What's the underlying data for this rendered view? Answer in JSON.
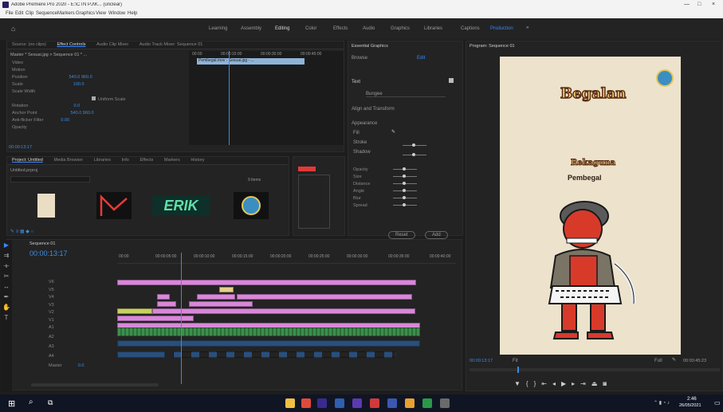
{
  "window": {
    "title": "Adobe Premiere Pro 2020 - E:\\CTN PJ\\K... (unclear)",
    "controls": [
      "—",
      "□",
      "×"
    ]
  },
  "menu": [
    "File",
    "Edit",
    "Clip",
    "Sequence",
    "Markers",
    "Graphics",
    "View",
    "Window",
    "Help"
  ],
  "workspaces": {
    "items": [
      "Learning",
      "Assembly",
      "Editing",
      "Color",
      "Effects",
      "Audio",
      "Graphics",
      "Libraries",
      "Captions",
      "Production"
    ],
    "active": "Editing"
  },
  "source_panel": {
    "tabs": [
      "Source: (no clips)",
      "Effect Controls",
      "Audio Clip Mixer",
      "Audio Track Mixer: Sequence 01"
    ],
    "active_tab": "Effect Controls",
    "header_clip": "Master * Sesuai.jpg > Sequence 01 * ...",
    "timecodes": [
      "00:00",
      "00:00:15:00",
      "00:00:30:00",
      "00:00:45:00"
    ],
    "highlight_clip": "Pembegal.mov - Sesuai.jpg - ...",
    "properties": [
      {
        "name": "Video",
        "value": ""
      },
      {
        "name": "Motion",
        "value": ""
      },
      {
        "name": "Position",
        "value": "540.0  960.0"
      },
      {
        "name": "Scale",
        "value": "100.0"
      },
      {
        "name": "Scale Width",
        "value": ""
      },
      {
        "name": "Uniform Scale",
        "value": ""
      },
      {
        "name": "Rotation",
        "value": "0.0"
      },
      {
        "name": "Anchor Point",
        "value": "540.0  960.0"
      },
      {
        "name": "Anti-flicker Filter",
        "value": "0.00"
      },
      {
        "name": "Opacity",
        "value": ""
      }
    ],
    "footer_time": "00:00:13:17"
  },
  "project_panel": {
    "tabs": [
      "Project: Untitled",
      "Media Browser",
      "Libraries",
      "Info",
      "Effects",
      "Markers",
      "History"
    ],
    "path": "Untitled.prproj",
    "search_placeholder": "",
    "count": "9 items",
    "thumbnails": [
      "paper",
      "logo-mark",
      "ERIK",
      "badge"
    ]
  },
  "essential_graphics": {
    "title": "Essential Graphics",
    "tabs": [
      "Browse",
      "Edit"
    ],
    "section": "Text",
    "font": "Bungee",
    "align_label": "Align and Transform",
    "appearance": "Appearance",
    "fill": "Fill",
    "stroke": "Stroke",
    "shadow": "Shadow",
    "sliders": [
      "Opacity",
      "Size",
      "Distance",
      "Angle",
      "Blur",
      "Spread"
    ],
    "buttons": [
      "Reset",
      "Add"
    ]
  },
  "program_monitor": {
    "title": "Program: Sequence 01",
    "timecode_left": "00:00:13:17",
    "fit": "Fit",
    "full": "Full",
    "timecode_right": "00:00:45:23",
    "poster": {
      "title": "Begalan",
      "subtitle": "Rekaguna",
      "line3": "Pembegal"
    }
  },
  "timeline": {
    "tab": "Sequence 01",
    "timecode": "00:00:13:17",
    "ruler": [
      "00:00",
      "00:00:05:00",
      "00:00:10:00",
      "00:00:15:00",
      "00:00:20:00",
      "00:00:25:00",
      "00:00:30:00",
      "00:00:35:00",
      "00:00:40:00"
    ],
    "tracks": [
      "V6",
      "V5",
      "V4",
      "V3",
      "V2",
      "V1",
      "A1",
      "A2",
      "A3",
      "A4"
    ],
    "master": "Master",
    "master_value": "0.0"
  },
  "taskbar": {
    "time": "2:46",
    "date": "26/05/2021"
  }
}
